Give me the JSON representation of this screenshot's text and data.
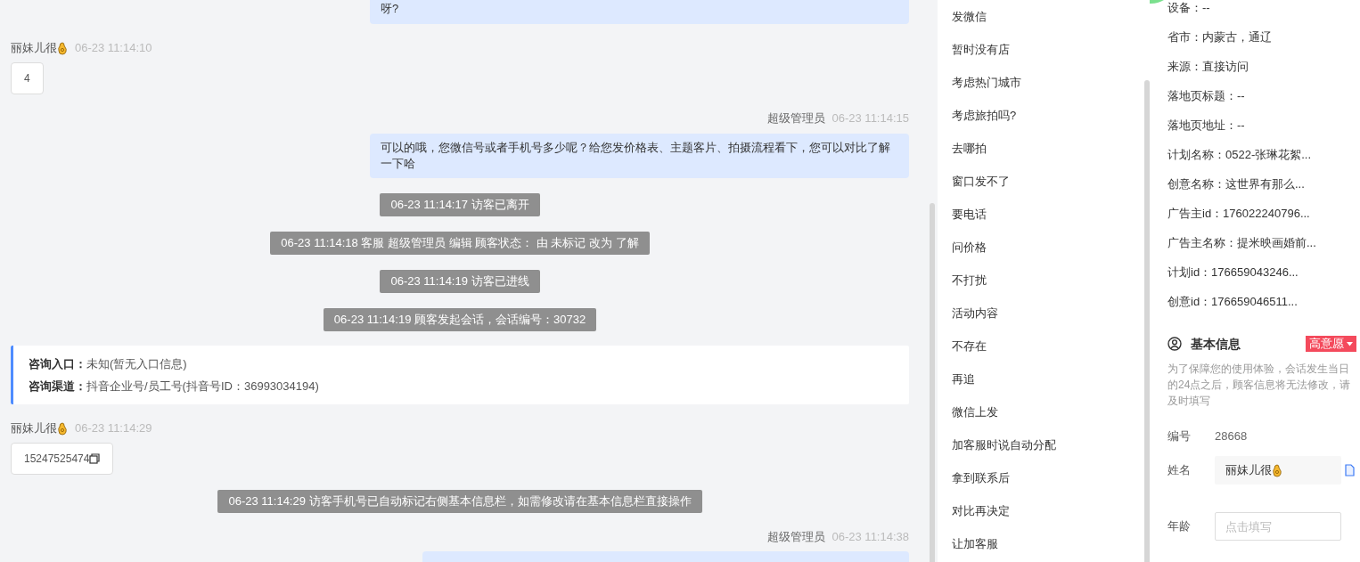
{
  "chat": {
    "messages": [
      {
        "kind": "agent",
        "text": "呀?"
      },
      {
        "kind": "visitor",
        "sender": "丽妹儿很",
        "time": "06-23 11:14:10",
        "text": "4"
      },
      {
        "kind": "agent",
        "sender": "超级管理员",
        "time": "06-23 11:14:15",
        "text": "可以的哦，您微信号或者手机号多少呢？给您发价格表、主题客片、拍摄流程看下，您可以对比了解一下哈"
      },
      {
        "kind": "system",
        "text": "06-23 11:14:17 访客已离开"
      },
      {
        "kind": "system",
        "text": "06-23 11:14:18 客服 超级管理员 编辑 顾客状态： 由 未标记 改为 了解"
      },
      {
        "kind": "system",
        "text": "06-23 11:14:19 访客已进线"
      },
      {
        "kind": "system",
        "text": "06-23 11:14:19 顾客发起会话，会话编号：30732"
      },
      {
        "kind": "source",
        "lines": [
          {
            "label": "咨询入口：",
            "value": "未知(暂无入口信息)"
          },
          {
            "label": "咨询渠道：",
            "value": "抖音企业号/员工号(抖音号ID：36993034194)"
          }
        ]
      },
      {
        "kind": "visitor",
        "sender": "丽妹儿很",
        "time": "06-23 11:14:29",
        "text": "15247525474",
        "copyable": true
      },
      {
        "kind": "system",
        "text": "06-23 11:14:29 访客手机号已自动标记右侧基本信息栏，如需修改请在基本信息栏直接操作"
      },
      {
        "kind": "agent",
        "sender": "超级管理员",
        "time": "06-23 11:14:38"
      }
    ]
  },
  "quick_replies": [
    "发微信",
    "暂时没有店",
    "考虑热门城市",
    "考虑旅拍吗?",
    "去哪拍",
    "窗口发不了",
    "要电话",
    "问价格",
    "不打扰",
    "活动内容",
    "不存在",
    "再追",
    "微信上发",
    "加客服时说自动分配",
    "拿到联系后",
    "对比再决定",
    "让加客服"
  ],
  "visitor_info": [
    "设备：--",
    "省市：内蒙古，通辽",
    "来源：直接访问",
    "落地页标题：--",
    "落地页地址：--",
    "计划名称：0522-张琳花絮...",
    "创意名称：这世界有那么...",
    "广告主id：176022240796...",
    "广告主名称：提米映画婚前...",
    "计划id：176659043246...",
    "创意id：176659046511..."
  ],
  "basic_info": {
    "title": "基本信息",
    "intent_badge": "高意愿",
    "notice": "为了保障您的使用体验，会话发生当日的24点之后，顾客信息将无法修改，请及时填写",
    "fields": [
      {
        "kind": "text",
        "label": "编号",
        "value": "28668"
      },
      {
        "kind": "name",
        "label": "姓名",
        "value": "丽妹儿很"
      },
      {
        "kind": "input",
        "label": "年龄",
        "placeholder": "点击填写"
      }
    ]
  }
}
